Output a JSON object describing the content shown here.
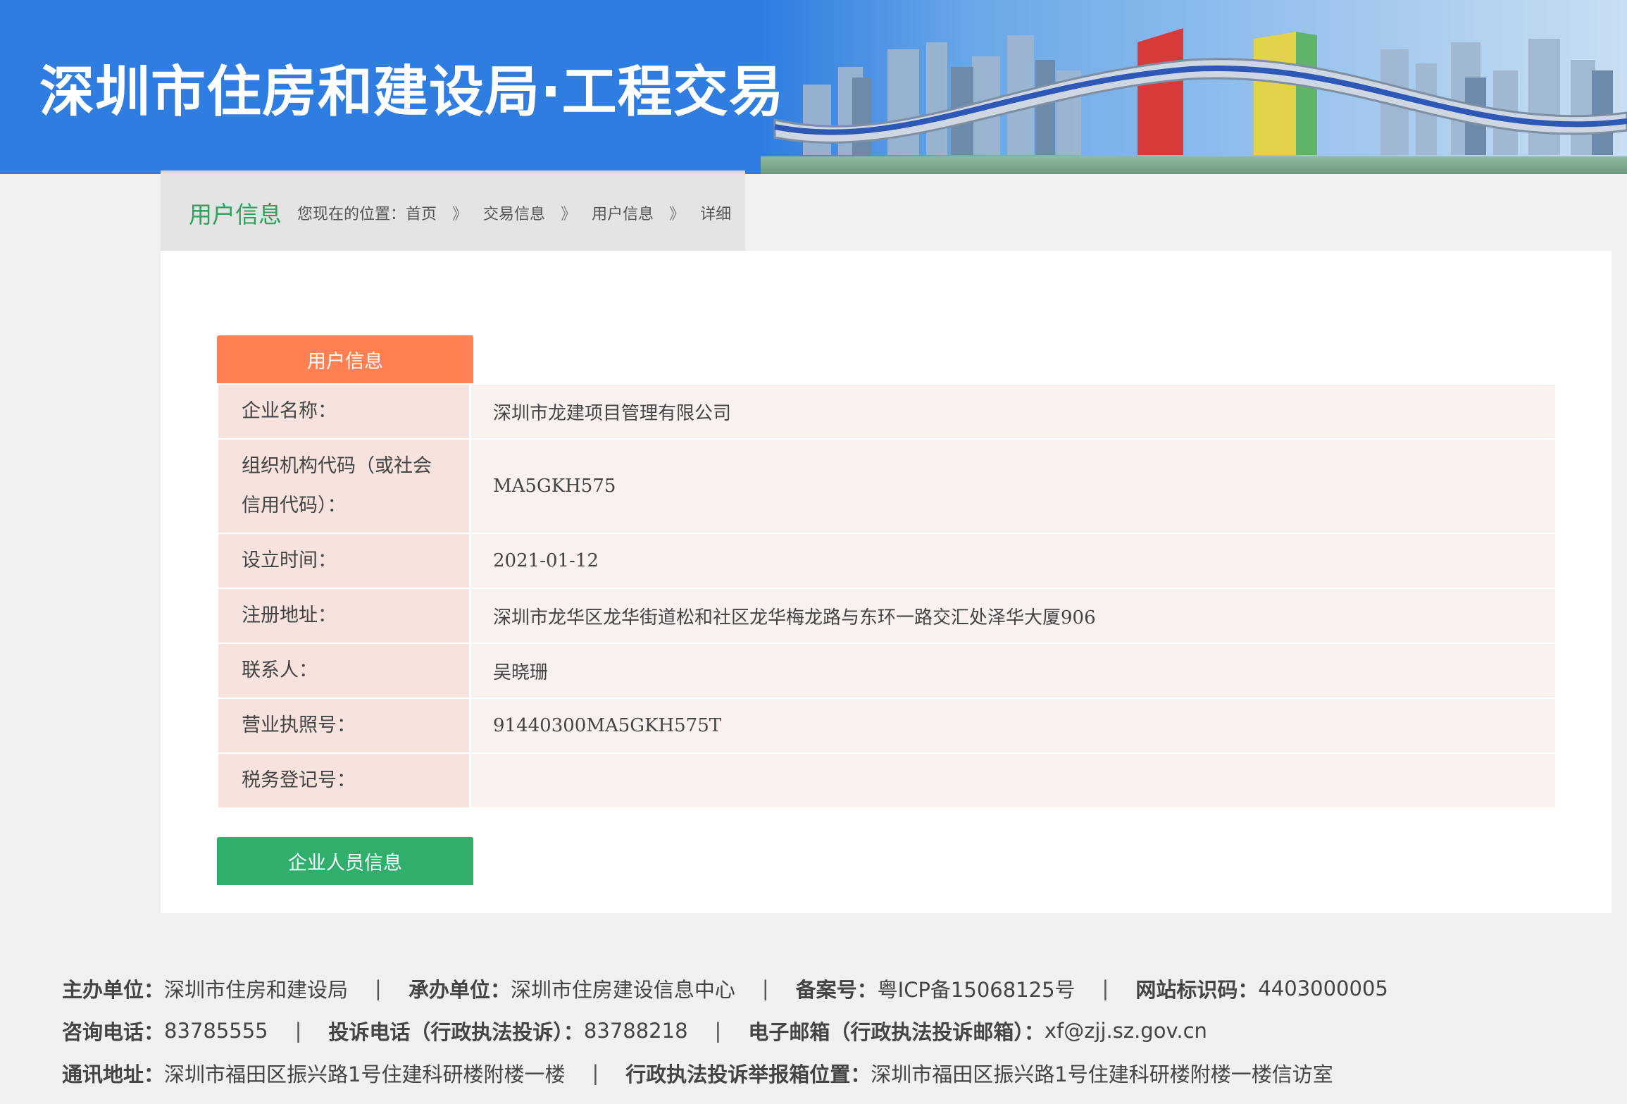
{
  "header": {
    "title": "深圳市住房和建设局·工程交易"
  },
  "breadcrumb": {
    "section_title": "用户信息",
    "prefix": "您现在的位置：",
    "items": [
      "首页",
      "交易信息",
      "用户信息",
      "详细"
    ],
    "separator": "》"
  },
  "user_info": {
    "section_label": "用户信息",
    "rows": [
      {
        "label": "企业名称：",
        "value": "深圳市龙建项目管理有限公司"
      },
      {
        "label": "组织机构代码（或社会信用代码）：",
        "value": "MA5GKH575"
      },
      {
        "label": "设立时间：",
        "value": "2021-01-12"
      },
      {
        "label": "注册地址：",
        "value": "深圳市龙华区龙华街道松和社区龙华梅龙路与东环一路交汇处泽华大厦906"
      },
      {
        "label": "联系人：",
        "value": "吴晓珊"
      },
      {
        "label": "营业执照号：",
        "value": "91440300MA5GKH575T"
      },
      {
        "label": "税务登记号：",
        "value": ""
      }
    ],
    "staff_button_label": "企业人员信息"
  },
  "footer": {
    "sponsor_label": "主办单位：",
    "sponsor": "深圳市住房和建设局",
    "organizer_label": "承办单位：",
    "organizer": "深圳市住房建设信息中心",
    "icp_label": "备案号：",
    "icp": "粤ICP备15068125号",
    "site_code_label": "网站标识码：",
    "site_code": "4403000005",
    "hotline_label": "咨询电话：",
    "hotline": "83785555",
    "complaint_label": "投诉电话（行政执法投诉）：",
    "complaint": "83788218",
    "email_label": "电子邮箱（行政执法投诉邮箱）：",
    "email": "xf@zjj.sz.gov.cn",
    "address_label": "通讯地址：",
    "address": "深圳市福田区振兴路1号住建科研楼附楼一楼",
    "box_label": "行政执法投诉举报箱位置：",
    "box": "深圳市福田区振兴路1号住建科研楼附楼一楼信访室"
  },
  "colors": {
    "header_blue": "#2f7de1",
    "accent_green": "#2aa15d",
    "section_orange": "#ff8052",
    "button_green": "#2fae6c"
  }
}
